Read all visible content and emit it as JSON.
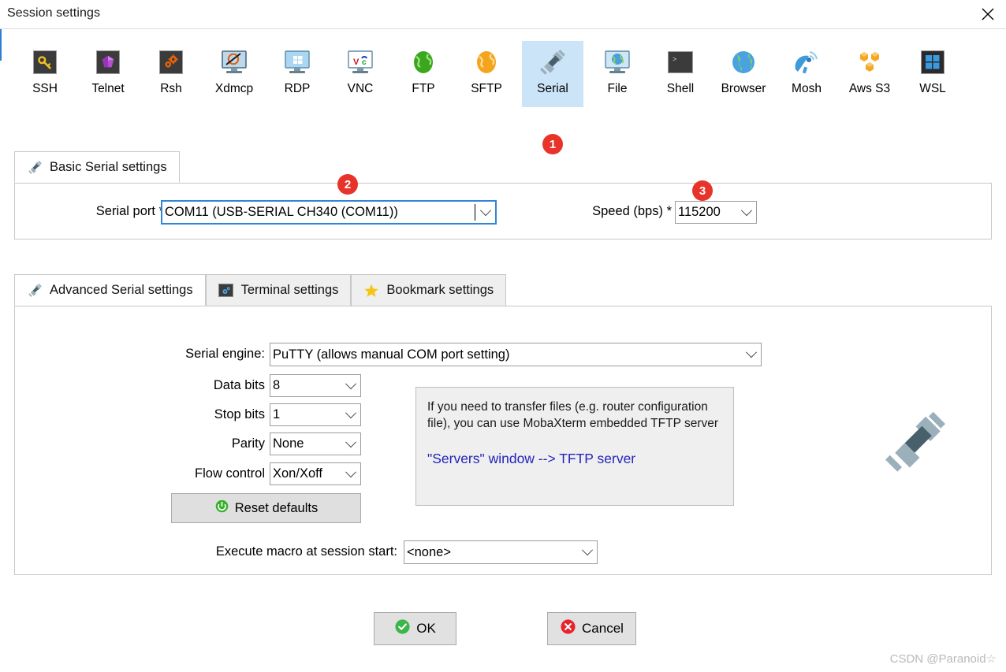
{
  "window": {
    "title": "Session settings",
    "close_icon": "close-icon"
  },
  "toolbar": {
    "items": [
      {
        "label": "SSH",
        "icon": "key-icon"
      },
      {
        "label": "Telnet",
        "icon": "gem-icon"
      },
      {
        "label": "Rsh",
        "icon": "gears-icon"
      },
      {
        "label": "Xdmcp",
        "icon": "monitor-x-icon"
      },
      {
        "label": "RDP",
        "icon": "monitor-windows-icon"
      },
      {
        "label": "VNC",
        "icon": "monitor-vnc-icon"
      },
      {
        "label": "FTP",
        "icon": "globe-green-icon"
      },
      {
        "label": "SFTP",
        "icon": "globe-orange-icon"
      },
      {
        "label": "Serial",
        "icon": "plug-icon",
        "selected": true,
        "badge": "1"
      },
      {
        "label": "File",
        "icon": "monitor-globe-icon"
      },
      {
        "label": "Shell",
        "icon": "terminal-icon"
      },
      {
        "label": "Browser",
        "icon": "globe-blue-icon"
      },
      {
        "label": "Mosh",
        "icon": "satellite-dish-icon"
      },
      {
        "label": "Aws S3",
        "icon": "aws-cubes-icon"
      },
      {
        "label": "WSL",
        "icon": "windows-icon"
      }
    ]
  },
  "basic": {
    "tab_label": "Basic Serial settings",
    "tab_icon": "plug-icon",
    "serial_port_label": "Serial port *",
    "serial_port_value": "COM11  (USB-SERIAL CH340 (COM11))",
    "serial_port_badge": "2",
    "speed_label": "Speed (bps) *",
    "speed_value": "115200",
    "speed_badge": "3"
  },
  "advanced": {
    "tabs": [
      {
        "label": "Advanced Serial settings",
        "icon": "plug-icon",
        "active": true
      },
      {
        "label": "Terminal settings",
        "icon": "gears-blue-icon",
        "active": false
      },
      {
        "label": "Bookmark settings",
        "icon": "star-icon",
        "active": false
      }
    ],
    "serial_engine_label": "Serial engine:",
    "serial_engine_value": "PuTTY   (allows manual COM port setting)",
    "fields": [
      {
        "label": "Data bits",
        "value": "8"
      },
      {
        "label": "Stop bits",
        "value": "1"
      },
      {
        "label": "Parity",
        "value": "None"
      },
      {
        "label": "Flow control",
        "value": "Xon/Xoff"
      }
    ],
    "reset_button": "Reset defaults",
    "reset_icon": "reset-icon",
    "macro_label": "Execute macro at session start:",
    "macro_value": "<none>",
    "info_text": "If you need to transfer files (e.g. router configuration file), you can use MobaXterm embedded TFTP server",
    "info_link": "\"Servers\" window  -->  TFTP server",
    "big_icon": "plug-icon"
  },
  "footer": {
    "ok_label": "OK",
    "ok_icon": "check-circle-icon",
    "cancel_label": "Cancel",
    "cancel_icon": "x-circle-icon"
  },
  "watermark": "CSDN @Paranoid☆",
  "colors": {
    "accent_selected": "#cce4f7",
    "badge_red": "#e8332a",
    "link_blue": "#2323bb",
    "focus_blue": "#2f86d4"
  }
}
